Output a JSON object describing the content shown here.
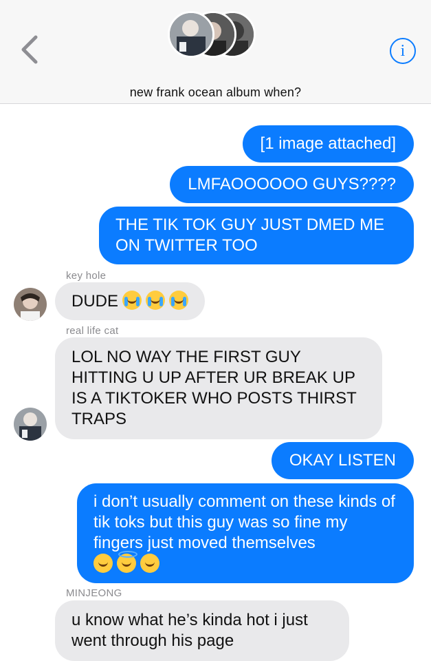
{
  "header": {
    "title": "new frank ocean album when?",
    "info_label": "i"
  },
  "messages": [
    {
      "id": "m1",
      "type": "out",
      "text": "[1 image attached]"
    },
    {
      "id": "m2",
      "type": "out",
      "text": "LMFAOOOOOO GUYS????"
    },
    {
      "id": "m3",
      "type": "out",
      "text": "THE TIK TOK GUY JUST DMED ME ON TWITTER TOO"
    },
    {
      "id": "m4",
      "type": "in",
      "sender": "key hole",
      "text": "DUDE",
      "emoji": [
        "crying-face",
        "crying-face",
        "crying-face"
      ]
    },
    {
      "id": "m5",
      "type": "in",
      "sender": "real life cat",
      "text": "LOL NO WAY THE FIRST GUY HITTING U UP AFTER UR BREAK UP IS A TIKTOKER WHO POSTS THIRST TRAPS"
    },
    {
      "id": "m6",
      "type": "out",
      "text": "OKAY LISTEN"
    },
    {
      "id": "m7",
      "type": "out",
      "text": "i don’t usually comment on these kinds of tik toks but this guy was so fine my fingers just moved themselves",
      "emoji": [
        "laughing-face",
        "halo-face",
        "sweat-smile-face"
      ]
    },
    {
      "id": "m8",
      "type": "in",
      "sender": "MINJEONG",
      "text": "u know what he’s kinda hot i just went through his page"
    }
  ],
  "colors": {
    "outgoing_bubble": "#0b7cff",
    "incoming_bubble": "#e9e9eb",
    "header_bg": "#f7f7f7"
  }
}
